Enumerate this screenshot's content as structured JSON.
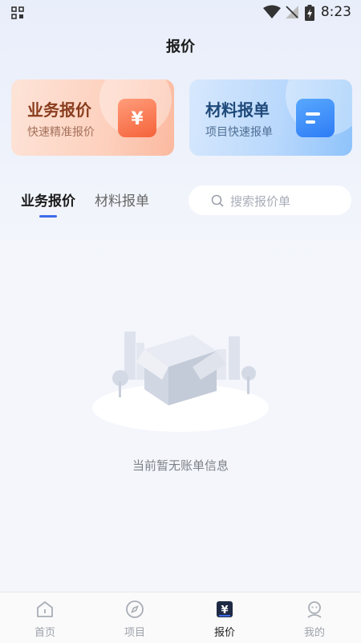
{
  "status_bar": {
    "time": "8:23"
  },
  "header": {
    "title": "报价"
  },
  "cards": [
    {
      "title": "业务报价",
      "subtitle": "快速精准报价",
      "icon": "yen-tag-icon"
    },
    {
      "title": "材料报单",
      "subtitle": "项目快速报单",
      "icon": "document-list-icon"
    }
  ],
  "tabs": [
    {
      "label": "业务报价",
      "active": true
    },
    {
      "label": "材料报单",
      "active": false
    }
  ],
  "search": {
    "placeholder": "搜索报价单"
  },
  "empty_state": {
    "message": "当前暂无账单信息"
  },
  "bottom_nav": [
    {
      "label": "首页",
      "icon": "home-icon",
      "active": false
    },
    {
      "label": "项目",
      "icon": "compass-icon",
      "active": false
    },
    {
      "label": "报价",
      "icon": "quote-icon",
      "active": true
    },
    {
      "label": "我的",
      "icon": "profile-icon",
      "active": false
    }
  ],
  "colors": {
    "accent": "#3d6bea",
    "biz_card": "#fdd0bd",
    "mat_card": "#b9d8fc"
  }
}
